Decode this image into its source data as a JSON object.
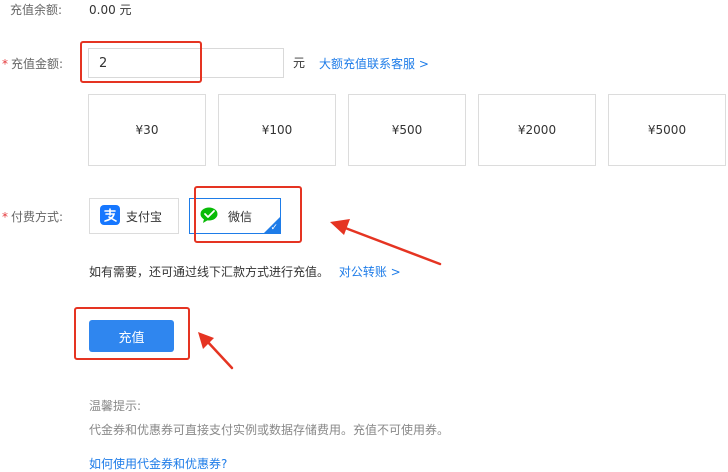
{
  "balance": {
    "label": "充值余额:",
    "value": "0.00 元"
  },
  "amount": {
    "required_mark": "*",
    "label": "充值金额:",
    "value": "2",
    "unit": "元",
    "large_link": "大额充值联系客服 >"
  },
  "presets": [
    "¥30",
    "¥100",
    "¥500",
    "¥2000",
    "¥5000"
  ],
  "payment": {
    "required_mark": "*",
    "label": "付费方式:",
    "methods": [
      {
        "label": "支付宝",
        "icon": "alipay-icon",
        "color": "#1677ff",
        "selected": false
      },
      {
        "label": "微信",
        "icon": "wechat-icon",
        "color": "#09bb07",
        "selected": true
      }
    ]
  },
  "offline": {
    "text": "如有需要，还可通过线下汇款方式进行充值。",
    "link": "对公转账 >"
  },
  "submit_label": "充值",
  "tips": {
    "title": "温馨提示:",
    "text": "代金券和优惠券可直接支付实例或数据存储费用。充值不可使用券。",
    "link": "如何使用代金券和优惠券?"
  },
  "colors": {
    "accent": "#1e7ce8",
    "button": "#2f86ef",
    "annotation": "#e53422"
  }
}
